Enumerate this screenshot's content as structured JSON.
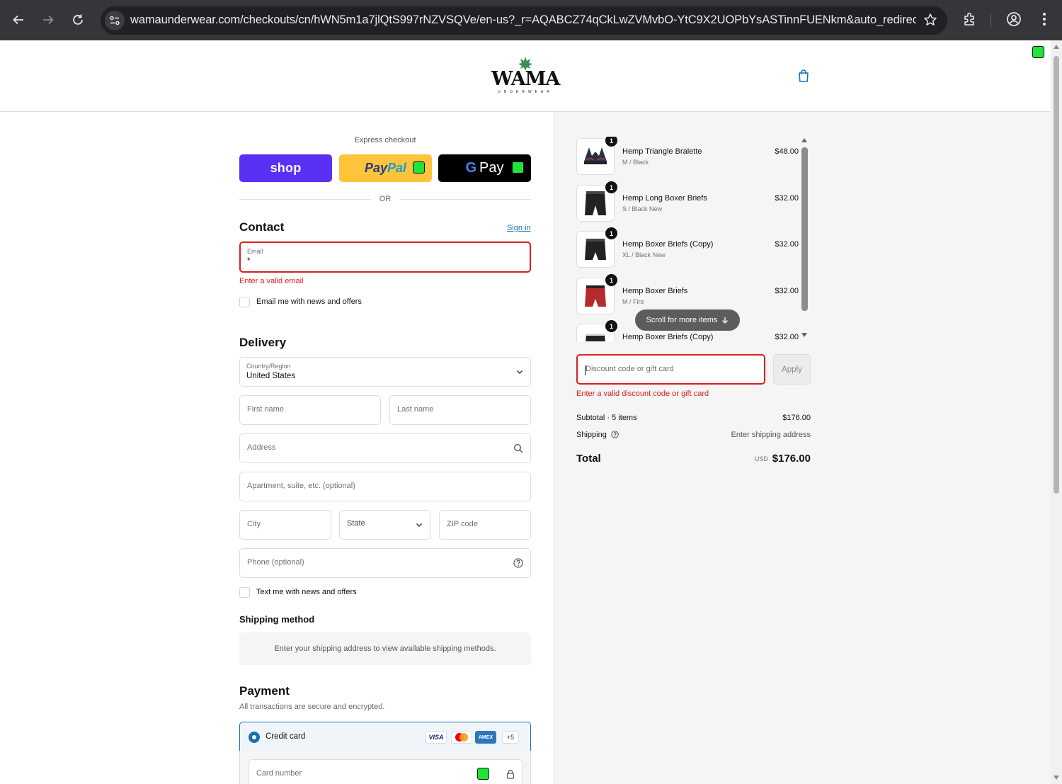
{
  "browser": {
    "url": "wamaunderwear.com/checkouts/cn/hWN5m1a7jlQtS997rNZVSQVe/en-us?_r=AQABCZ74qCkLwZVMvbO-YtC9X2UOPbYsASTinnFUENkm&auto_redirec..."
  },
  "header": {
    "logo_text": "WAMA",
    "logo_sub": "UNDERWEAR"
  },
  "express": {
    "label": "Express checkout",
    "shop_label": "shop",
    "paypal_pay": "Pay",
    "paypal_pal": "Pal",
    "gpay_g": "G",
    "gpay_label": "Pay",
    "or_label": "OR"
  },
  "contact": {
    "title": "Contact",
    "sign_in": "Sign in",
    "email_label": "Email",
    "email_value": "*",
    "email_error": "Enter a valid email",
    "newsletter_label": "Email me with news and offers"
  },
  "delivery": {
    "title": "Delivery",
    "country_label": "Country/Region",
    "country_value": "United States",
    "first_name": "First name",
    "last_name": "Last name",
    "address": "Address",
    "apartment": "Apartment, suite, etc. (optional)",
    "city": "City",
    "state": "State",
    "zip": "ZIP code",
    "phone": "Phone (optional)",
    "sms_label": "Text me with news and offers"
  },
  "shipping": {
    "title": "Shipping method",
    "note": "Enter your shipping address to view available shipping methods."
  },
  "payment": {
    "title": "Payment",
    "subtitle": "All transactions are secure and encrypted.",
    "method": "Credit card",
    "card_visa": "VISA",
    "card_amex": "AMEX",
    "card_more": "+5",
    "card_number": "Card number"
  },
  "order": {
    "items": [
      {
        "qty": "1",
        "name": "Hemp Triangle Bralette",
        "variant": "M / Black",
        "price": "$48.00"
      },
      {
        "qty": "1",
        "name": "Hemp Long Boxer Briefs",
        "variant": "S / Black New",
        "price": "$32.00"
      },
      {
        "qty": "1",
        "name": "Hemp Boxer Briefs (Copy)",
        "variant": "XL / Black New",
        "price": "$32.00"
      },
      {
        "qty": "1",
        "name": "Hemp Boxer Briefs",
        "variant": "M / Fire",
        "price": "$32.00"
      },
      {
        "qty": "1",
        "name": "Hemp Boxer Briefs (Copy)",
        "variant": "",
        "price": "$32.00"
      }
    ],
    "scroll_more": "Scroll for more items",
    "discount_placeholder": "Discount code or gift card",
    "apply_label": "Apply",
    "discount_error": "Enter a valid discount code or gift card",
    "subtotal_label": "Subtotal · 5 items",
    "subtotal_value": "$176.00",
    "shipping_label": "Shipping",
    "shipping_value": "Enter shipping address",
    "total_label": "Total",
    "currency": "USD",
    "total_value": "$176.00"
  },
  "colors": {
    "accent": "#1773b0",
    "error": "#dd1d1d",
    "shop_purple": "#5a31f4",
    "paypal_yellow": "#ffc439",
    "indicator_green": "#22e33a"
  }
}
